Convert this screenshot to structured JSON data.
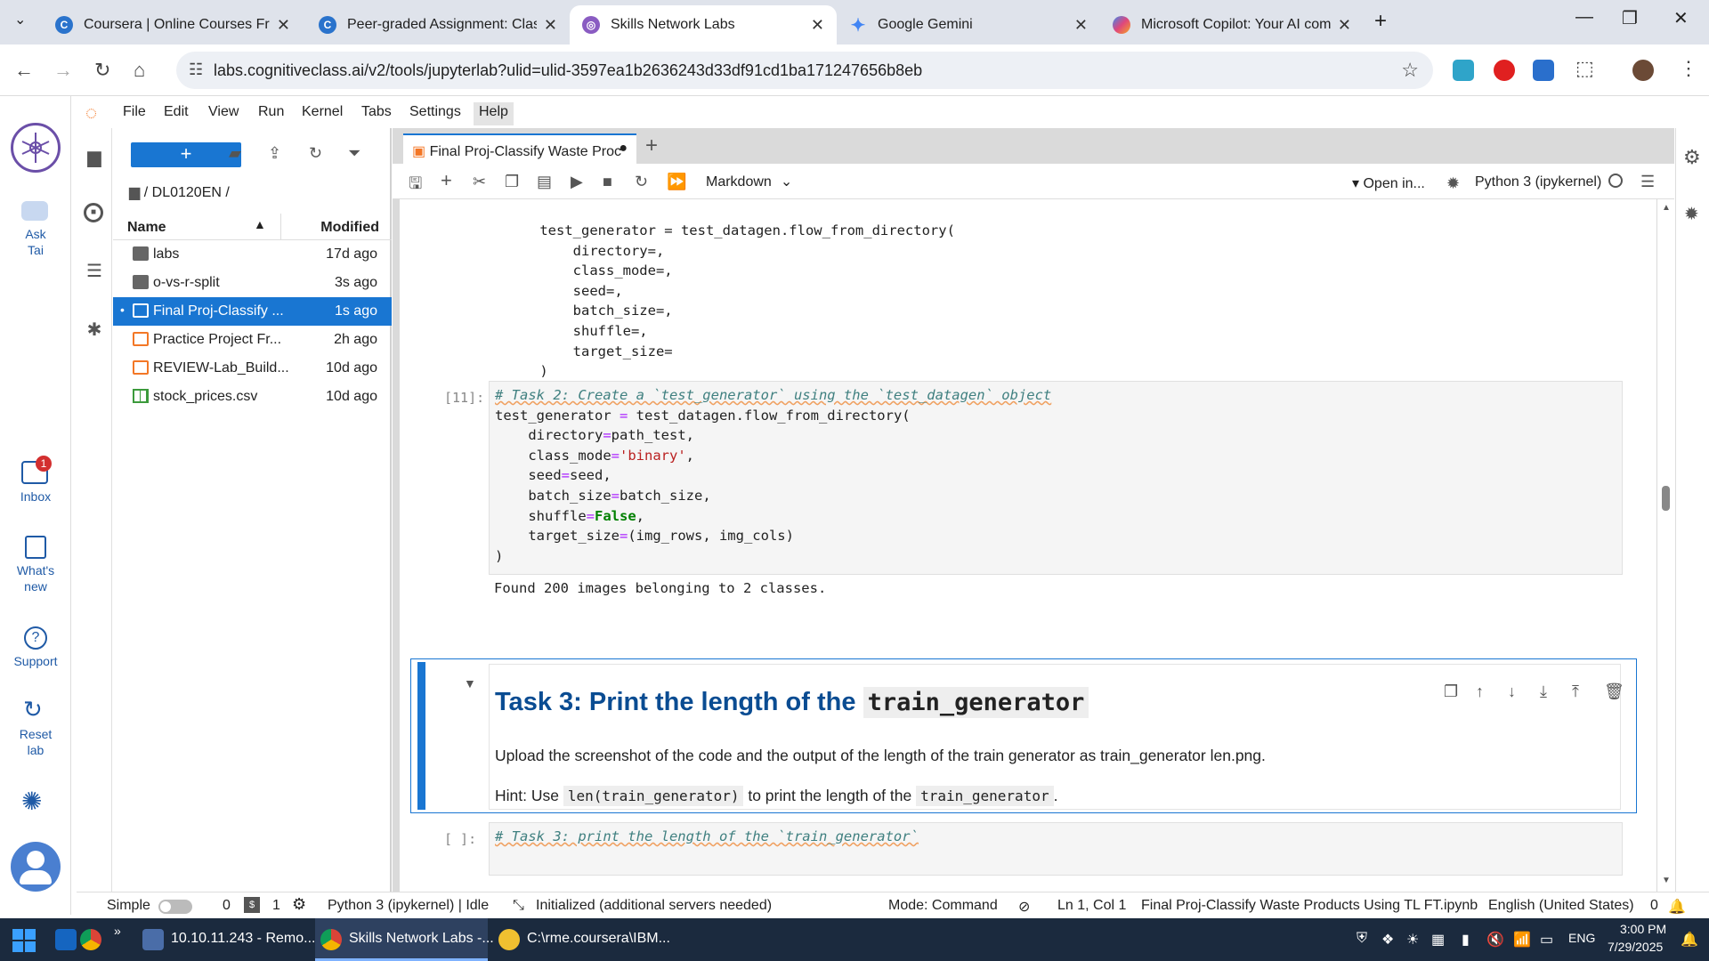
{
  "browser": {
    "tabs": [
      {
        "title": "Coursera | Online Courses From",
        "icon": "coursera-icon",
        "color": "#2a73cc"
      },
      {
        "title": "Peer-graded Assignment: Classi",
        "icon": "coursera-icon",
        "color": "#2a73cc"
      },
      {
        "title": "Skills Network Labs",
        "icon": "skills-network-icon",
        "color": "#8a5cc2"
      },
      {
        "title": "Google Gemini",
        "icon": "gemini-icon",
        "color": "#4285f4"
      },
      {
        "title": "Microsoft Copilot: Your AI comp",
        "icon": "copilot-icon",
        "color": "#e0467c"
      }
    ],
    "url": "labs.cognitiveclass.ai/v2/tools/jupyterlab?ulid=ulid-3597ea1b2636243d33df91cd1ba171247656b8eb"
  },
  "menu": [
    "File",
    "Edit",
    "View",
    "Run",
    "Kernel",
    "Tabs",
    "Settings",
    "Help"
  ],
  "left_strip": {
    "ask": "Ask\nTai",
    "inbox": "Inbox",
    "inbox_badge": "1",
    "whats_new": "What's\nnew",
    "support": "Support",
    "reset": "Reset\nlab"
  },
  "file_browser": {
    "breadcrumb": "/ DL0120EN /",
    "col_name": "Name",
    "col_modified": "Modified",
    "files": [
      {
        "name": "labs",
        "modified": "17d ago",
        "type": "folder"
      },
      {
        "name": "o-vs-r-split",
        "modified": "3s ago",
        "type": "folder"
      },
      {
        "name": "Final Proj-Classify ...",
        "modified": "1s ago",
        "type": "notebook"
      },
      {
        "name": "Practice Project Fr...",
        "modified": "2h ago",
        "type": "notebook"
      },
      {
        "name": "REVIEW-Lab_Build...",
        "modified": "10d ago",
        "type": "notebook"
      },
      {
        "name": "stock_prices.csv",
        "modified": "10d ago",
        "type": "csv"
      }
    ]
  },
  "notebook": {
    "tab_title": "Final Proj-Classify Waste Proc",
    "cell_type": "Markdown",
    "open_in": "Open in...",
    "kernel": "Python 3 (ipykernel)",
    "md_code": "    test_generator = test_datagen.flow_from_directory(\n        directory=,\n        class_mode=,\n        seed=,\n        batch_size=,\n        shuffle=,\n        target_size=\n    )",
    "cell11_prompt": "[11]:",
    "cell11_comment": "# Task 2: Create a `test_generator` using the `test_datagen` object",
    "cell11_output": "Found 200 images belonging to 2 classes.",
    "task3_heading": "Task 3: Print the length of the ",
    "task3_heading_code": "train_generator",
    "task3_desc": "Upload the screenshot of the code and the output of the length of the train generator as train_generator len.png.",
    "task3_hint_pre": "Hint: Use ",
    "task3_hint_code1": "len(train_generator)",
    "task3_hint_mid": " to print the length of the ",
    "task3_hint_code2": "train_generator",
    "task3_hint_end": ".",
    "next_prompt": "[ ]:",
    "next_comment": "# Task 3: print the length of the `train_generator`"
  },
  "status": {
    "mode_label": "Simple",
    "n0": "0",
    "n1": "1",
    "kernel": "Python 3 (ipykernel) | Idle",
    "init": "Initialized (additional servers needed)",
    "mode": "Mode: Command",
    "pos": "Ln 1, Col 1",
    "file": "Final Proj-Classify Waste Products Using TL FT.ipynb",
    "lang": "English (United States)",
    "notif": "0"
  },
  "taskbar": {
    "items": [
      "10.10.11.243 - Remo...",
      "Skills Network Labs -...",
      "C:\\rme.coursera\\IBM..."
    ],
    "lang": "ENG",
    "time": "3:00 PM",
    "date": "7/29/2025"
  }
}
